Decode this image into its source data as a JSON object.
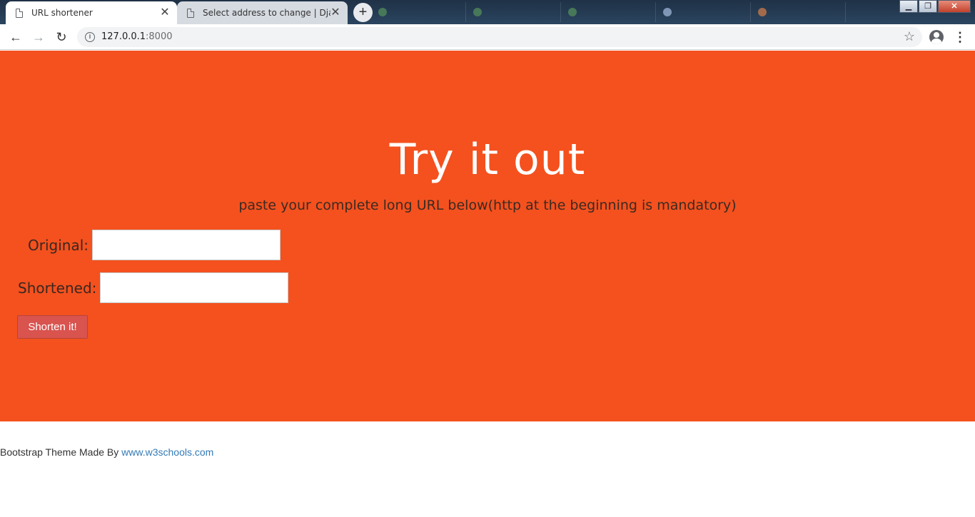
{
  "browser": {
    "tabs": [
      {
        "title": "URL shortener",
        "active": true
      },
      {
        "title": "Select address to change | Django",
        "active": false
      }
    ],
    "new_tab_label": "+",
    "address": {
      "host": "127.0.0.1",
      "port": ":8000"
    }
  },
  "hero": {
    "title": "Try it out",
    "subtitle": "paste your complete long URL below(http at the beginning is mandatory)",
    "original_label": "Original:",
    "original_value": "",
    "shortened_label": "Shortened:",
    "shortened_value": "",
    "button_label": "Shorten it!",
    "background": "#f4511e"
  },
  "footer": {
    "text": "Bootstrap Theme Made By",
    "link": "www.w3schools.com"
  }
}
